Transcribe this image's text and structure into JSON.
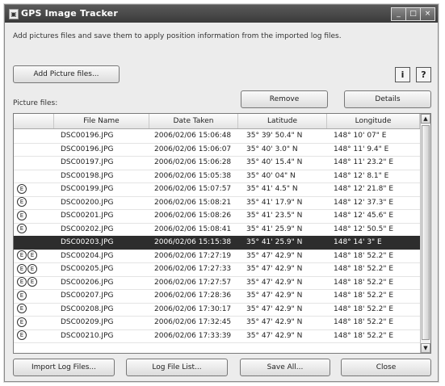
{
  "window": {
    "title": "GPS Image Tracker",
    "icon": "app-icon"
  },
  "titlebar_buttons": {
    "minimize": "_",
    "maximize": "□",
    "close": "×"
  },
  "description": "Add pictures files and save them to apply position information from the imported log files.",
  "buttons": {
    "add_pictures": "Add Picture files...",
    "remove": "Remove",
    "details": "Details",
    "import_log": "Import Log Files...",
    "log_file_list": "Log File List...",
    "save_all": "Save All...",
    "close": "Close"
  },
  "icon_buttons": {
    "info": "i",
    "help": "?"
  },
  "picture_files_label": "Picture files:",
  "table": {
    "columns": [
      "File Name",
      "Date Taken",
      "Latitude",
      "Longitude"
    ],
    "rows": [
      {
        "badges": "",
        "file": "DSC00196.JPG",
        "date": "2006/02/06 15:06:48",
        "lat": "35° 39' 50.4\" N",
        "lon": "148° 10' 07\" E"
      },
      {
        "badges": "",
        "file": "DSC00196.JPG",
        "date": "2006/02/06 15:06:07",
        "lat": "35° 40' 3.0\" N",
        "lon": "148° 11' 9.4\" E"
      },
      {
        "badges": "",
        "file": "DSC00197.JPG",
        "date": "2006/02/06 15:06:28",
        "lat": "35° 40' 15.4\" N",
        "lon": "148° 11' 23.2\" E"
      },
      {
        "badges": "",
        "file": "DSC00198.JPG",
        "date": "2006/02/06 15:05:38",
        "lat": "35° 40' 04\" N",
        "lon": "148° 12' 8.1\" E"
      },
      {
        "badges": "E",
        "file": "DSC00199.JPG",
        "date": "2006/02/06 15:07:57",
        "lat": "35° 41' 4.5\" N",
        "lon": "148° 12' 21.8\" E"
      },
      {
        "badges": "E",
        "file": "DSC00200.JPG",
        "date": "2006/02/06 15:08:21",
        "lat": "35° 41' 17.9\" N",
        "lon": "148° 12' 37.3\" E"
      },
      {
        "badges": "E",
        "file": "DSC00201.JPG",
        "date": "2006/02/06 15:08:26",
        "lat": "35° 41' 23.5\" N",
        "lon": "148° 12' 45.6\" E"
      },
      {
        "badges": "E",
        "file": "DSC00202.JPG",
        "date": "2006/02/06 15:08:41",
        "lat": "35° 41' 25.9\" N",
        "lon": "148° 12' 50.5\" E"
      },
      {
        "badges": "",
        "file": "DSC00203.JPG",
        "date": "2006/02/06 15:15:38",
        "lat": "35° 41' 25.9\" N",
        "lon": "148° 14' 3\" E",
        "selected": true
      },
      {
        "badges": "EE",
        "file": "DSC00204.JPG",
        "date": "2006/02/06 17:27:19",
        "lat": "35° 47' 42.9\" N",
        "lon": "148° 18' 52.2\" E"
      },
      {
        "badges": "EE",
        "file": "DSC00205.JPG",
        "date": "2006/02/06 17:27:33",
        "lat": "35° 47' 42.9\" N",
        "lon": "148° 18' 52.2\" E"
      },
      {
        "badges": "EE",
        "file": "DSC00206.JPG",
        "date": "2006/02/06 17:27:57",
        "lat": "35° 47' 42.9\" N",
        "lon": "148° 18' 52.2\" E"
      },
      {
        "badges": "E",
        "file": "DSC00207.JPG",
        "date": "2006/02/06 17:28:36",
        "lat": "35° 47' 42.9\" N",
        "lon": "148° 18' 52.2\" E"
      },
      {
        "badges": "E",
        "file": "DSC00208.JPG",
        "date": "2006/02/06 17:30:17",
        "lat": "35° 47' 42.9\" N",
        "lon": "148° 18' 52.2\" E"
      },
      {
        "badges": "E",
        "file": "DSC00209.JPG",
        "date": "2006/02/06 17:32:45",
        "lat": "35° 47' 42.9\" N",
        "lon": "148° 18' 52.2\" E"
      },
      {
        "badges": "E",
        "file": "DSC00210.JPG",
        "date": "2006/02/06 17:33:39",
        "lat": "35° 47' 42.9\" N",
        "lon": "148° 18' 52.2\" E"
      }
    ]
  }
}
